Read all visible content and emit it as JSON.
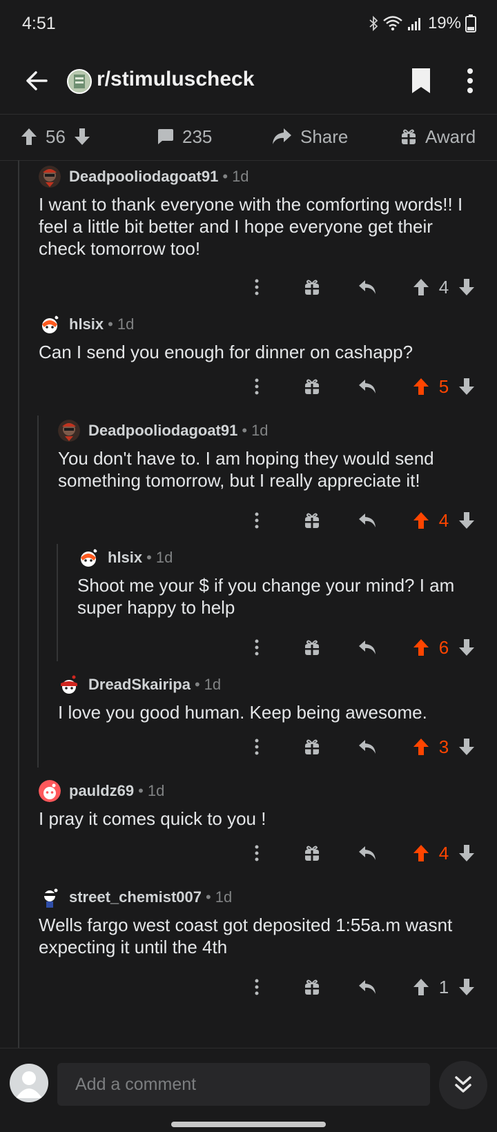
{
  "status_bar": {
    "time": "4:51",
    "battery": "19%"
  },
  "header": {
    "subreddit": "r/stimuluscheck"
  },
  "post_actions": {
    "upvotes": "56",
    "comments": "235",
    "share_label": "Share",
    "award_label": "Award"
  },
  "comments": [
    {
      "user": "Deadpooliodagoat91",
      "sep": "•",
      "time": "1d",
      "body": "I want to thank everyone with the comforting words!! I feel a little bit better and I hope everyone get their check tomorrow too!",
      "score": "4",
      "upvoted": false
    },
    {
      "user": "hlsix",
      "sep": "•",
      "time": "1d",
      "body": "Can I send you enough for dinner on cashapp?",
      "score": "5",
      "upvoted": true
    },
    {
      "user": "Deadpooliodagoat91",
      "sep": "•",
      "time": "1d",
      "body": "You don't have to. I am hoping they would send something tomorrow, but I really appreciate it!",
      "score": "4",
      "upvoted": true
    },
    {
      "user": "hlsix",
      "sep": "•",
      "time": "1d",
      "body": "Shoot me your $ if you change your mind? I am super happy to help",
      "score": "6",
      "upvoted": true
    },
    {
      "user": "DreadSkairipa",
      "sep": "•",
      "time": "1d",
      "body": "I love you good human. Keep being awesome.",
      "score": "3",
      "upvoted": true
    },
    {
      "user": "pauldz69",
      "sep": "•",
      "time": "1d",
      "body": "I pray it comes quick to you !",
      "score": "4",
      "upvoted": true
    },
    {
      "user": "street_chemist007",
      "sep": "•",
      "time": "1d",
      "body": "Wells fargo west coast got deposited 1:55a.m wasnt expecting it until the 4th",
      "score": "1",
      "upvoted": false
    }
  ],
  "composer": {
    "placeholder": "Add a comment"
  },
  "colors": {
    "upvote": "#ff4500",
    "neutral_icon": "#b9bcbe",
    "background": "#1a1a1b"
  },
  "icons": [
    "back-arrow-icon",
    "bookmark-icon",
    "more-vertical-icon",
    "upvote-icon",
    "downvote-icon",
    "comment-icon",
    "share-icon",
    "award-icon",
    "reply-icon",
    "chevron-double-down-icon"
  ]
}
